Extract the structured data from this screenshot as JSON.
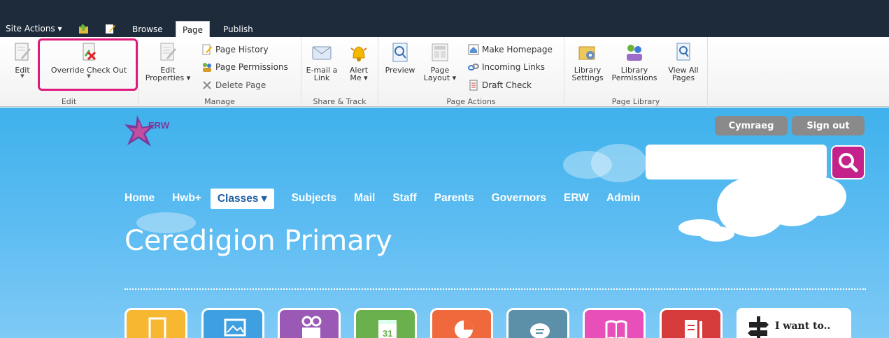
{
  "topbar": {
    "site_actions": "Site Actions ▾",
    "tabs": [
      "Browse",
      "Page",
      "Publish"
    ]
  },
  "ribbon": {
    "groups": {
      "edit": {
        "label": "Edit",
        "edit_btn": "Edit",
        "override_btn": "Override Check Out"
      },
      "manage": {
        "label": "Manage",
        "edit_properties": [
          "Edit",
          "Properties ▾"
        ],
        "page_history": "Page History",
        "page_permissions": "Page Permissions",
        "delete_page": "Delete Page"
      },
      "share": {
        "label": "Share & Track",
        "email": [
          "E-mail a",
          "Link"
        ],
        "alert": [
          "Alert",
          "Me ▾"
        ]
      },
      "page_actions": {
        "label": "Page Actions",
        "preview": "Preview",
        "page_layout": [
          "Page",
          "Layout ▾"
        ],
        "make_homepage": "Make Homepage",
        "incoming_links": "Incoming Links",
        "draft_check": "Draft Check"
      },
      "library": {
        "label": "Page Library",
        "settings": [
          "Library",
          "Settings"
        ],
        "permissions": [
          "Library",
          "Permissions"
        ],
        "view_all": [
          "View All",
          "Pages"
        ]
      }
    }
  },
  "page": {
    "logo_text": "ERW",
    "language_button": "Cymraeg",
    "signout_button": "Sign out",
    "search_placeholder": "",
    "nav": [
      "Home",
      "Hwb+",
      "Classes ▾",
      "Subjects",
      "Mail",
      "Staff",
      "Parents",
      "Governors",
      "ERW",
      "Admin"
    ],
    "title": "Ceredigion Primary",
    "i_want_to": "I want to..",
    "tile_colors": [
      "#f7b731",
      "#3ea0e0",
      "#9b59b6",
      "#6ab04c",
      "#f0693d",
      "#5c8fa8",
      "#e84fb8",
      "#d63b3b"
    ]
  }
}
